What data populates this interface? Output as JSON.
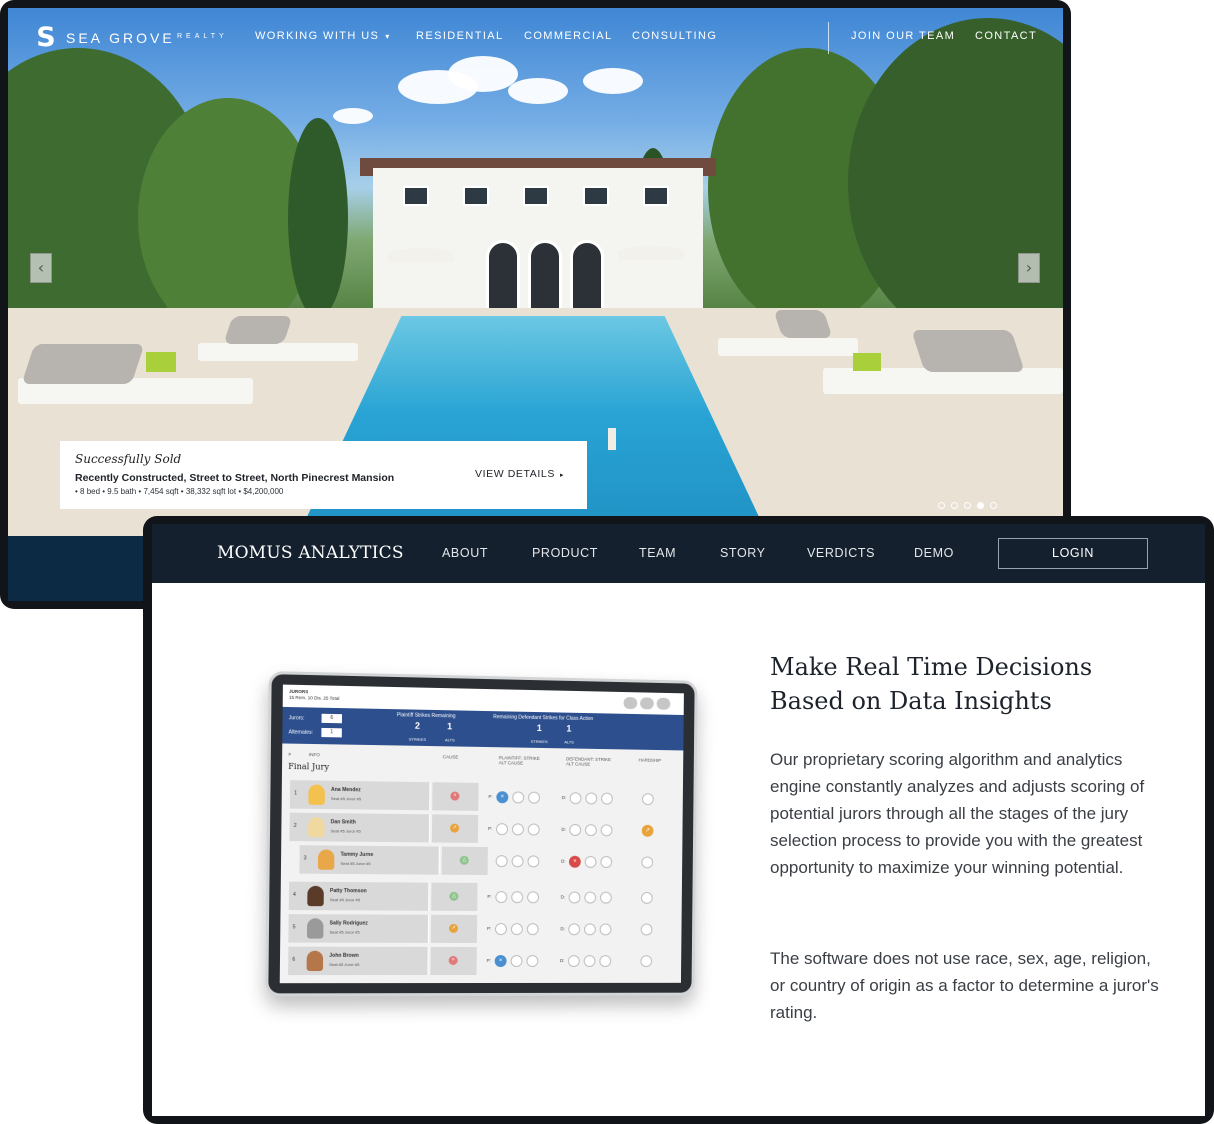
{
  "realty": {
    "logo_mark": "S",
    "logo_name": "SEA GROVE",
    "logo_sub": "REALTY",
    "nav": {
      "working_with_us": "WORKING WITH US",
      "residential": "RESIDENTIAL",
      "commercial": "COMMERCIAL",
      "consulting": "CONSULTING",
      "join_our_team": "JOIN OUR TEAM",
      "contact": "CONTACT"
    },
    "icons": {
      "caret": "▾",
      "prev": "‹",
      "next": "›",
      "details_caret": "▸"
    },
    "slider": {
      "dots": 5,
      "active_index": 3
    },
    "listing": {
      "status": "Successfully Sold",
      "title": "Recently Constructed, Street to Street, North Pinecrest Mansion",
      "meta": "• 8 bed  • 9.5 bath  • 7,454 sqft  • 38,332 sqft lot  • $4,200,000",
      "cta": "VIEW DETAILS"
    }
  },
  "momus": {
    "brand": "MOMUS ANALYTICS",
    "nav": {
      "about": "ABOUT",
      "product": "PRODUCT",
      "team": "TEAM",
      "story": "STORY",
      "verdicts": "VERDICTS",
      "demo": "DEMO",
      "login": "LOGIN"
    },
    "headline_line1": "Make Real Time Decisions",
    "headline_line2": "Based on Data Insights",
    "paragraph1": "Our proprietary scoring algorithm and analytics engine constantly analyzes and adjusts scoring of potential jurors through all the stages of the jury selection process to provide you with the greatest opportunity to maximize your winning potential.",
    "paragraph2": "The software does not use race, sex, age, religion, or country of origin as a factor to determine a juror's rating.",
    "tablet": {
      "top_label": "JURORS",
      "top_counts": "15 Rem.  10 Dis.  25 Total",
      "jurors_label": "Jurors:",
      "jurors_value": "6",
      "alternates_label": "Alternates:",
      "alternates_value": "1",
      "plaintiff_header": "Plaintiff Strikes Remaining",
      "plaintiff_strikes": "2",
      "plaintiff_alts": "1",
      "defendant_header": "Remaining Defendant Strikes for Class Action",
      "defendant_strikes": "1",
      "defendant_alts": "1",
      "strikes_label": "STRIKES",
      "alts_label": "ALTS",
      "col_num": "#",
      "col_info": "INFO",
      "col_cause": "CAUSE",
      "col_plaintiff": "PLAINTIFF: STRIKE ALT CAUSE",
      "col_defendant": "DEFENDANT: STRIKE ALT CAUSE",
      "col_hardship": "HARDSHIP",
      "final_jury": "Final Jury",
      "p_label": "P:",
      "d_label": "D:",
      "jurors": [
        {
          "num": "1",
          "name": "Ana Mendez",
          "seat": "Seat #5 Juror #5"
        },
        {
          "num": "2",
          "name": "Dan Smith",
          "seat": "Seat #5 Juror #5"
        },
        {
          "num": "3",
          "name": "Tammy Jurne",
          "seat": "Seat #5 Juror #5"
        },
        {
          "num": "4",
          "name": "Patty Thomson",
          "seat": "Seat #5 Juror #5"
        },
        {
          "num": "5",
          "name": "Sally Rodriguez",
          "seat": "Seat #5 Juror #5"
        },
        {
          "num": "6",
          "name": "John Brown",
          "seat": "Seat #5 Juror #5"
        }
      ]
    }
  },
  "colors": {
    "momus_nav": "#14202e",
    "realty_footer": "#0d2a45",
    "tablet_band": "#2d4f8e",
    "pool": "#28a3d4"
  }
}
